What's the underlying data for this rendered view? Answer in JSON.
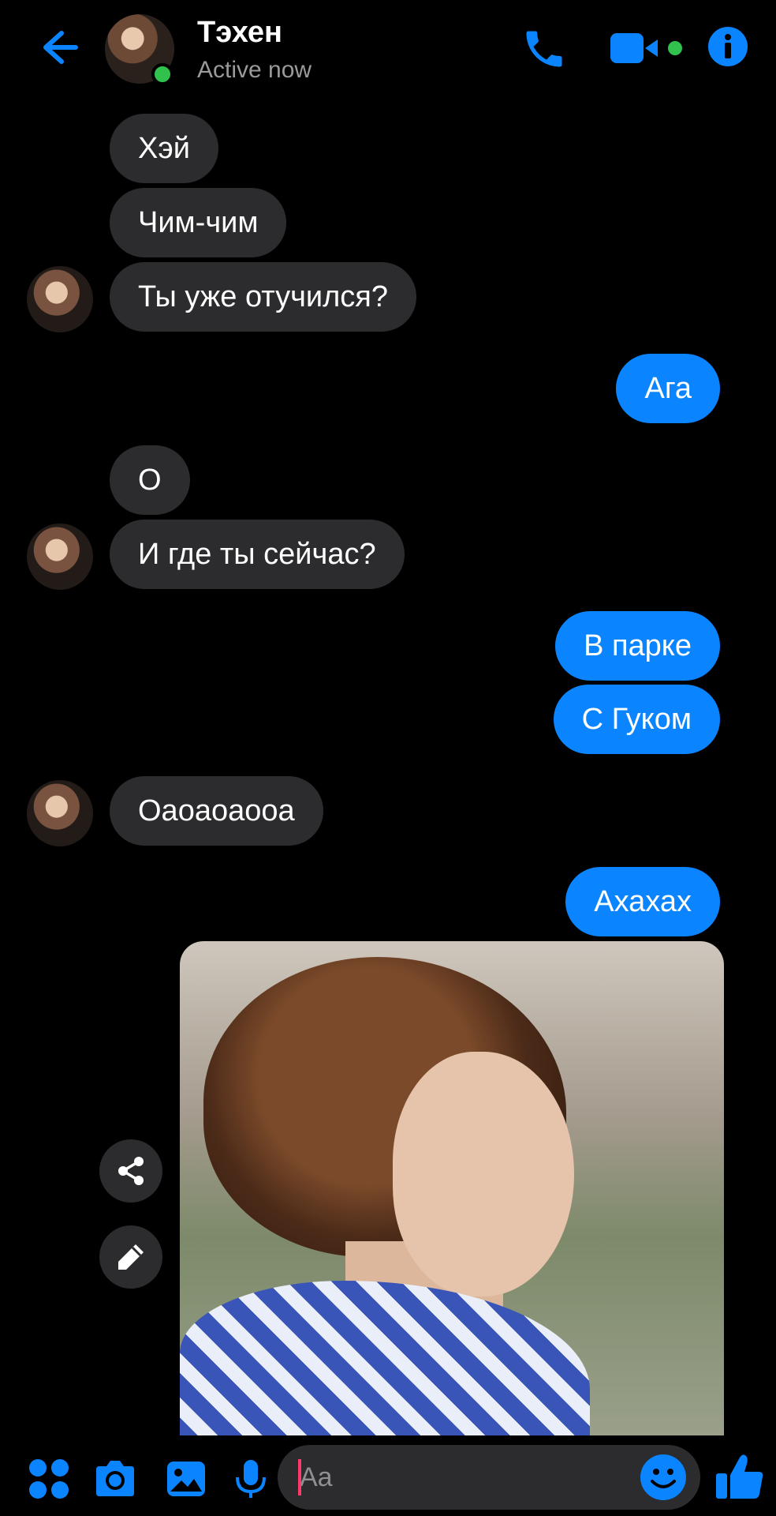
{
  "header": {
    "name": "Тэхен",
    "status": "Active now"
  },
  "messages": [
    {
      "side": "in",
      "text": "Хэй"
    },
    {
      "side": "in",
      "text": "Чим-чим"
    },
    {
      "side": "in",
      "text": "Ты уже отучился?"
    },
    {
      "side": "out",
      "text": "Ага"
    },
    {
      "side": "in",
      "text": "О"
    },
    {
      "side": "in",
      "text": "И где ты сейчас?"
    },
    {
      "side": "out",
      "text": "В парке"
    },
    {
      "side": "out",
      "text": "С Гуком"
    },
    {
      "side": "in",
      "text": "Оаоаоаооа"
    },
    {
      "side": "out",
      "text": "Ахахах"
    }
  ],
  "composer": {
    "placeholder": "Aa"
  },
  "icons": {
    "back": "arrow-left-icon",
    "call": "phone-icon",
    "video": "video-camera-icon",
    "info": "info-icon",
    "apps": "apps-grid-icon",
    "camera": "camera-icon",
    "gallery": "image-icon",
    "mic": "microphone-icon",
    "emoji": "emoji-icon",
    "like": "thumbs-up-icon",
    "share": "share-icon",
    "edit": "pencil-icon"
  },
  "colors": {
    "accent": "#0a84ff",
    "incoming_bubble": "#2c2c2e",
    "background": "#000000",
    "online": "#31c24d"
  }
}
